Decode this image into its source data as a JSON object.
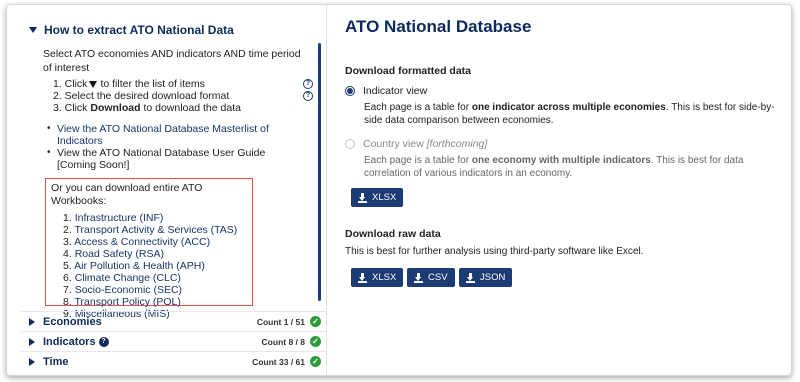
{
  "left": {
    "howto_title": "How to extract ATO National Data",
    "intro": "Select ATO economies AND indicators AND time period of interest",
    "steps": [
      {
        "prefix": "1. Click",
        "suffix": "to filter the list of items"
      },
      {
        "text": "2. Select the desired download format"
      },
      {
        "prefix": "3. Click",
        "bold": "Download",
        "suffix": "to download the data"
      }
    ],
    "help_icon": "?",
    "links": [
      {
        "text": "View the ATO National Database Masterlist of Indicators"
      },
      {
        "text": "View the ATO National Database User Guide"
      },
      {
        "text": "[Coming Soon!]"
      }
    ],
    "workbooks_heading": "Or you can download entire ATO Workbooks:",
    "workbooks": [
      {
        "num": "1.",
        "name": "Infrastructure (INF)"
      },
      {
        "num": "2.",
        "name": "Transport Activity & Services (TAS)"
      },
      {
        "num": "3.",
        "name": "Access & Connectivity (ACC)"
      },
      {
        "num": "4.",
        "name": "Road Safety (RSA)"
      },
      {
        "num": "5.",
        "name": "Air Pollution & Health (APH)"
      },
      {
        "num": "6.",
        "name": "Climate Change (CLC)"
      },
      {
        "num": "7.",
        "name": "Socio-Economic (SEC)"
      },
      {
        "num": "8.",
        "name": "Transport Policy (POL)"
      },
      {
        "num": "9.",
        "name": "Miscellaneous (MIS)"
      }
    ],
    "filters": [
      {
        "label": "Economies",
        "count": "Count 1 / 51"
      },
      {
        "label": "Indicators",
        "count": "Count 8 / 8"
      },
      {
        "label": "Time",
        "count": "Count 33 / 61"
      }
    ],
    "check": "✓"
  },
  "right": {
    "title": "ATO National Database",
    "formatted_heading": "Download formatted data",
    "indicator_view": "Indicator view",
    "indicator_desc_pre": "Each page is a table for ",
    "indicator_desc_bold": "one indicator across multiple economies",
    "indicator_desc_post": ". This is best for side-by-side data comparison between economies.",
    "country_view": "Country view",
    "country_view_note": "[forthcoming]",
    "country_desc_pre": "Each page is a table for ",
    "country_desc_bold": "one economy with multiple indicators",
    "country_desc_post": ". This is best for data correlation of various indicators in an economy.",
    "formatted_btn": "XLSX",
    "raw_heading": "Download raw data",
    "raw_desc": "This is best for further analysis using third-party software like Excel.",
    "raw_btns": [
      "XLSX",
      "CSV",
      "JSON"
    ]
  },
  "colors": {
    "navy": "#0d2a5c",
    "button": "#1c3a73",
    "highlight_border": "#e0534c",
    "check": "#2f9a3a"
  }
}
